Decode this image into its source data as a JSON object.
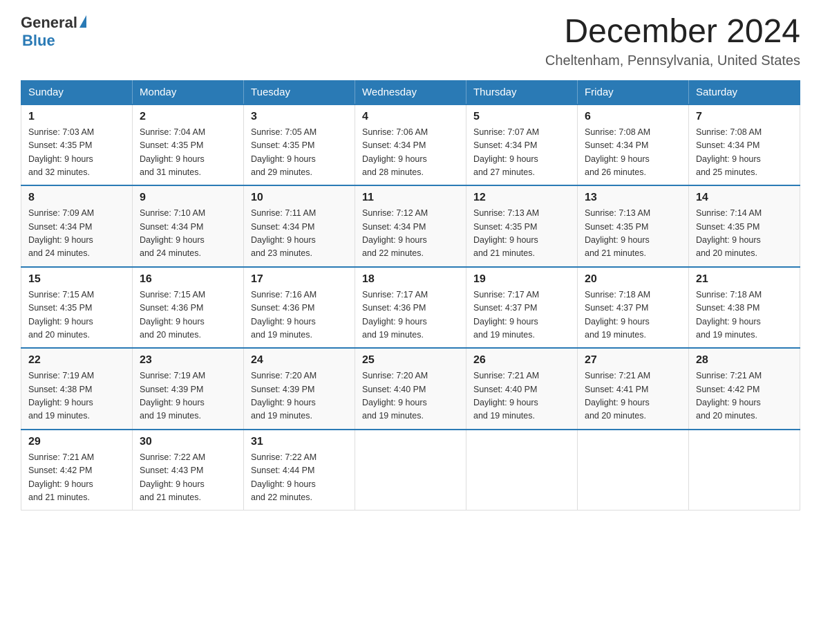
{
  "header": {
    "logo_general": "General",
    "logo_blue": "Blue",
    "month_title": "December 2024",
    "location": "Cheltenham, Pennsylvania, United States"
  },
  "weekdays": [
    "Sunday",
    "Monday",
    "Tuesday",
    "Wednesday",
    "Thursday",
    "Friday",
    "Saturday"
  ],
  "rows": [
    [
      {
        "day": "1",
        "sunrise": "7:03 AM",
        "sunset": "4:35 PM",
        "daylight": "9 hours and 32 minutes."
      },
      {
        "day": "2",
        "sunrise": "7:04 AM",
        "sunset": "4:35 PM",
        "daylight": "9 hours and 31 minutes."
      },
      {
        "day": "3",
        "sunrise": "7:05 AM",
        "sunset": "4:35 PM",
        "daylight": "9 hours and 29 minutes."
      },
      {
        "day": "4",
        "sunrise": "7:06 AM",
        "sunset": "4:34 PM",
        "daylight": "9 hours and 28 minutes."
      },
      {
        "day": "5",
        "sunrise": "7:07 AM",
        "sunset": "4:34 PM",
        "daylight": "9 hours and 27 minutes."
      },
      {
        "day": "6",
        "sunrise": "7:08 AM",
        "sunset": "4:34 PM",
        "daylight": "9 hours and 26 minutes."
      },
      {
        "day": "7",
        "sunrise": "7:08 AM",
        "sunset": "4:34 PM",
        "daylight": "9 hours and 25 minutes."
      }
    ],
    [
      {
        "day": "8",
        "sunrise": "7:09 AM",
        "sunset": "4:34 PM",
        "daylight": "9 hours and 24 minutes."
      },
      {
        "day": "9",
        "sunrise": "7:10 AM",
        "sunset": "4:34 PM",
        "daylight": "9 hours and 24 minutes."
      },
      {
        "day": "10",
        "sunrise": "7:11 AM",
        "sunset": "4:34 PM",
        "daylight": "9 hours and 23 minutes."
      },
      {
        "day": "11",
        "sunrise": "7:12 AM",
        "sunset": "4:34 PM",
        "daylight": "9 hours and 22 minutes."
      },
      {
        "day": "12",
        "sunrise": "7:13 AM",
        "sunset": "4:35 PM",
        "daylight": "9 hours and 21 minutes."
      },
      {
        "day": "13",
        "sunrise": "7:13 AM",
        "sunset": "4:35 PM",
        "daylight": "9 hours and 21 minutes."
      },
      {
        "day": "14",
        "sunrise": "7:14 AM",
        "sunset": "4:35 PM",
        "daylight": "9 hours and 20 minutes."
      }
    ],
    [
      {
        "day": "15",
        "sunrise": "7:15 AM",
        "sunset": "4:35 PM",
        "daylight": "9 hours and 20 minutes."
      },
      {
        "day": "16",
        "sunrise": "7:15 AM",
        "sunset": "4:36 PM",
        "daylight": "9 hours and 20 minutes."
      },
      {
        "day": "17",
        "sunrise": "7:16 AM",
        "sunset": "4:36 PM",
        "daylight": "9 hours and 19 minutes."
      },
      {
        "day": "18",
        "sunrise": "7:17 AM",
        "sunset": "4:36 PM",
        "daylight": "9 hours and 19 minutes."
      },
      {
        "day": "19",
        "sunrise": "7:17 AM",
        "sunset": "4:37 PM",
        "daylight": "9 hours and 19 minutes."
      },
      {
        "day": "20",
        "sunrise": "7:18 AM",
        "sunset": "4:37 PM",
        "daylight": "9 hours and 19 minutes."
      },
      {
        "day": "21",
        "sunrise": "7:18 AM",
        "sunset": "4:38 PM",
        "daylight": "9 hours and 19 minutes."
      }
    ],
    [
      {
        "day": "22",
        "sunrise": "7:19 AM",
        "sunset": "4:38 PM",
        "daylight": "9 hours and 19 minutes."
      },
      {
        "day": "23",
        "sunrise": "7:19 AM",
        "sunset": "4:39 PM",
        "daylight": "9 hours and 19 minutes."
      },
      {
        "day": "24",
        "sunrise": "7:20 AM",
        "sunset": "4:39 PM",
        "daylight": "9 hours and 19 minutes."
      },
      {
        "day": "25",
        "sunrise": "7:20 AM",
        "sunset": "4:40 PM",
        "daylight": "9 hours and 19 minutes."
      },
      {
        "day": "26",
        "sunrise": "7:21 AM",
        "sunset": "4:40 PM",
        "daylight": "9 hours and 19 minutes."
      },
      {
        "day": "27",
        "sunrise": "7:21 AM",
        "sunset": "4:41 PM",
        "daylight": "9 hours and 20 minutes."
      },
      {
        "day": "28",
        "sunrise": "7:21 AM",
        "sunset": "4:42 PM",
        "daylight": "9 hours and 20 minutes."
      }
    ],
    [
      {
        "day": "29",
        "sunrise": "7:21 AM",
        "sunset": "4:42 PM",
        "daylight": "9 hours and 21 minutes."
      },
      {
        "day": "30",
        "sunrise": "7:22 AM",
        "sunset": "4:43 PM",
        "daylight": "9 hours and 21 minutes."
      },
      {
        "day": "31",
        "sunrise": "7:22 AM",
        "sunset": "4:44 PM",
        "daylight": "9 hours and 22 minutes."
      },
      null,
      null,
      null,
      null
    ]
  ],
  "labels": {
    "sunrise_prefix": "Sunrise: ",
    "sunset_prefix": "Sunset: ",
    "daylight_prefix": "Daylight: "
  }
}
